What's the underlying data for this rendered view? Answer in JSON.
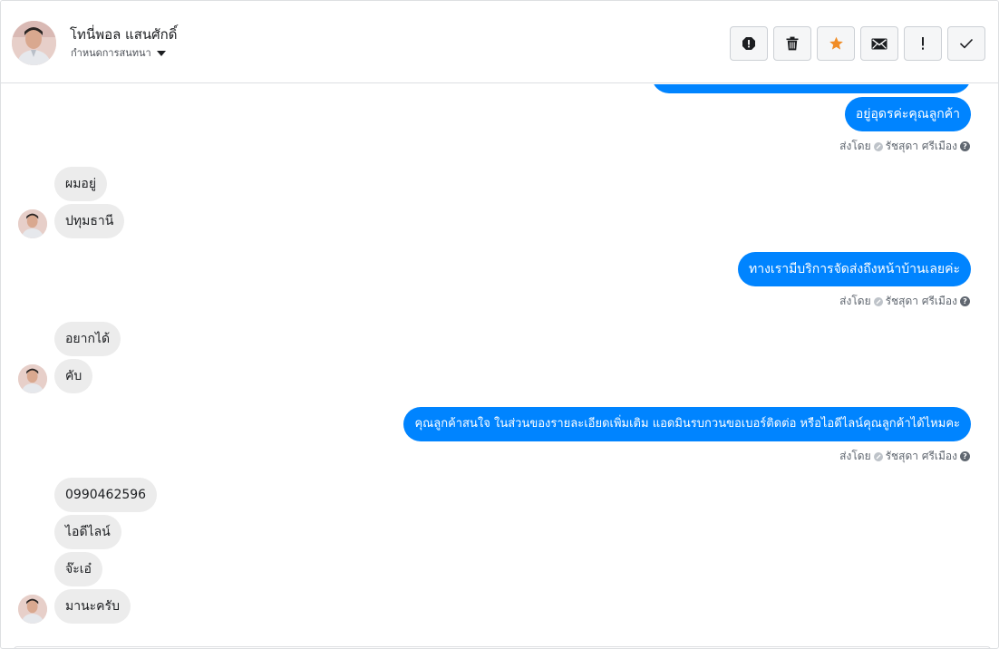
{
  "header": {
    "contact_name": "โทนี่พอล แสนศักดิ์",
    "label_text": "กำหนดการสนทนา",
    "actions": [
      {
        "name": "spam-button",
        "icon": "alert-circle-icon"
      },
      {
        "name": "delete-button",
        "icon": "trash-icon"
      },
      {
        "name": "star-button",
        "icon": "star-icon"
      },
      {
        "name": "mark-unread-button",
        "icon": "envelope-icon"
      },
      {
        "name": "important-button",
        "icon": "exclamation-icon"
      },
      {
        "name": "mark-done-button",
        "icon": "check-icon"
      }
    ]
  },
  "colors": {
    "outgoing_bubble": "#0084ff",
    "incoming_bubble": "#ececec",
    "star": "#f08c26"
  },
  "messages": {
    "out_1": "อยู่อุดรค่ะคุณลูกค้า",
    "sent_by_prefix": "ส่งโดย",
    "sent_by_name": "รัชสุดา ศรีเมือง",
    "in_1": "ผมอยู่",
    "in_2": "ปทุมธานี",
    "out_2": "ทางเรามีบริการจัดส่งถึงหน้าบ้านเลยค่ะ",
    "in_3": "อยากได้",
    "in_4": "คับ",
    "out_3": "คุณลูกค้าสนใจ ในส่วนของรายละเอียดเพิ่มเติม แอดมินรบกวนขอเบอร์ติดต่อ หรือไอดีไลน์คุณลูกค้าได้ไหมคะ",
    "in_5": "0990462596",
    "in_6": "ไอดีไลน์",
    "in_7": "จ๊ะเอ๋",
    "in_8": "มานะครับ"
  }
}
